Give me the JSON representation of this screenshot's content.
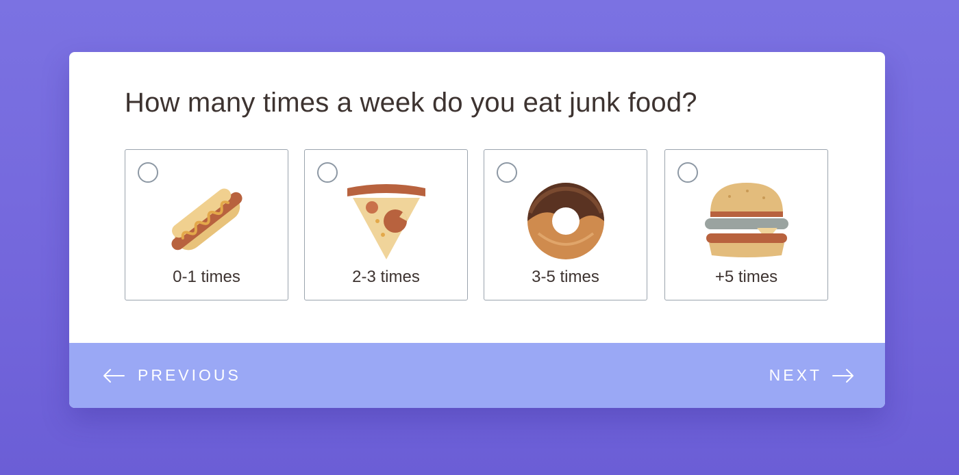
{
  "question": "How many times a week do you eat junk food?",
  "options": [
    {
      "label": "0-1 times",
      "icon": "hotdog-icon"
    },
    {
      "label": "2-3 times",
      "icon": "pizza-slice-icon"
    },
    {
      "label": "3-5 times",
      "icon": "donut-icon"
    },
    {
      "label": "+5 times",
      "icon": "burger-icon"
    }
  ],
  "nav": {
    "previous_label": "PREVIOUS",
    "next_label": "NEXT"
  },
  "colors": {
    "background": "#7467dc",
    "card": "#ffffff",
    "footer": "#9aa8f5",
    "text": "#3d3330",
    "border": "#9aa3ad"
  }
}
